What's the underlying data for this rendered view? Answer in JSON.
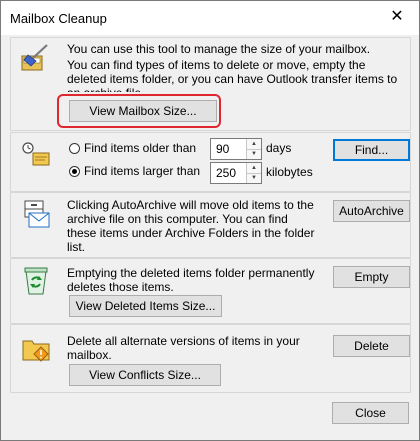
{
  "window": {
    "title": "Mailbox Cleanup",
    "close_glyph": "✕"
  },
  "mailbox_section": {
    "line1": "You can use this tool to manage the size of your mailbox.",
    "line2": "You can find types of items to delete or move, empty the deleted items folder, or you can have Outlook transfer items to an archive file.",
    "view_mailbox_size_button": "View Mailbox Size...",
    "icon": "broom-mailbox-icon",
    "highlight_color": "#e0262f"
  },
  "find_section": {
    "older_label": "Find items older than",
    "older_value": "90",
    "older_unit": "days",
    "larger_label": "Find items larger than",
    "larger_value": "250",
    "larger_unit": "kilobytes",
    "selected_option": "larger",
    "find_button": "Find...",
    "icon": "find-items-icon"
  },
  "autoarchive_section": {
    "text": "Clicking AutoArchive will move old items to the archive file on this computer. You can find these items under Archive Folders in the folder list.",
    "button": "AutoArchive",
    "icon": "archive-icon"
  },
  "deleted_section": {
    "text": "Emptying the deleted items folder permanently deletes those items.",
    "view_button": "View Deleted Items Size...",
    "empty_button": "Empty",
    "icon": "recycle-bin-icon"
  },
  "conflicts_section": {
    "text": "Delete all alternate versions of items in your mailbox.",
    "view_button": "View Conflicts Size...",
    "delete_button": "Delete",
    "icon": "conflicts-folder-icon"
  },
  "footer": {
    "close_button": "Close"
  }
}
